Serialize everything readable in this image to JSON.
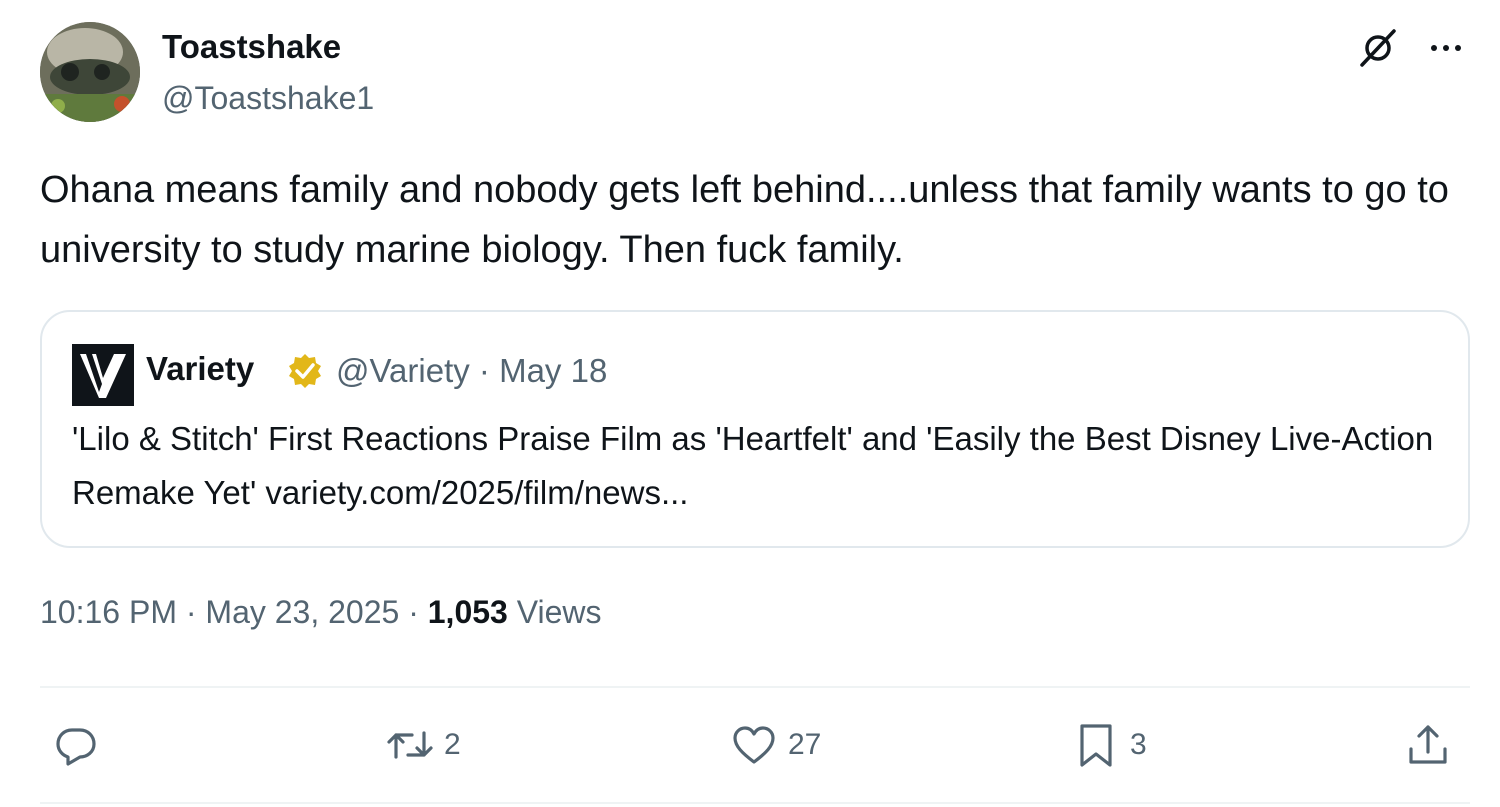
{
  "author": {
    "display_name": "Toastshake",
    "handle": "@Toastshake1"
  },
  "tweet": {
    "text": "Ohana means family and nobody gets left behind....unless that family wants to go to university to study marine biology. Then fuck family."
  },
  "quote": {
    "name": "Variety",
    "handle_and_date": "@Variety · May 18",
    "text": "'Lilo & Stitch' First Reactions Praise Film as 'Heartfelt' and 'Easily the Best Disney Live-Action Remake Yet' variety.com/2025/film/news..."
  },
  "meta": {
    "time_date": "10:16 PM · May 23, 2025 · ",
    "views_count": "1,053",
    "views_label": " Views"
  },
  "actions": {
    "replies": "",
    "retweets": "2",
    "likes": "27",
    "bookmarks": "3"
  },
  "icons": {
    "header": [
      "grok-icon",
      "more-icon"
    ],
    "actions": [
      "reply-icon",
      "retweet-icon",
      "like-icon",
      "bookmark-icon",
      "share-icon"
    ]
  },
  "colors": {
    "text": "#0f1419",
    "secondary": "#536471",
    "border": "#e1e8ed",
    "verified_gold": "#e2b719"
  }
}
